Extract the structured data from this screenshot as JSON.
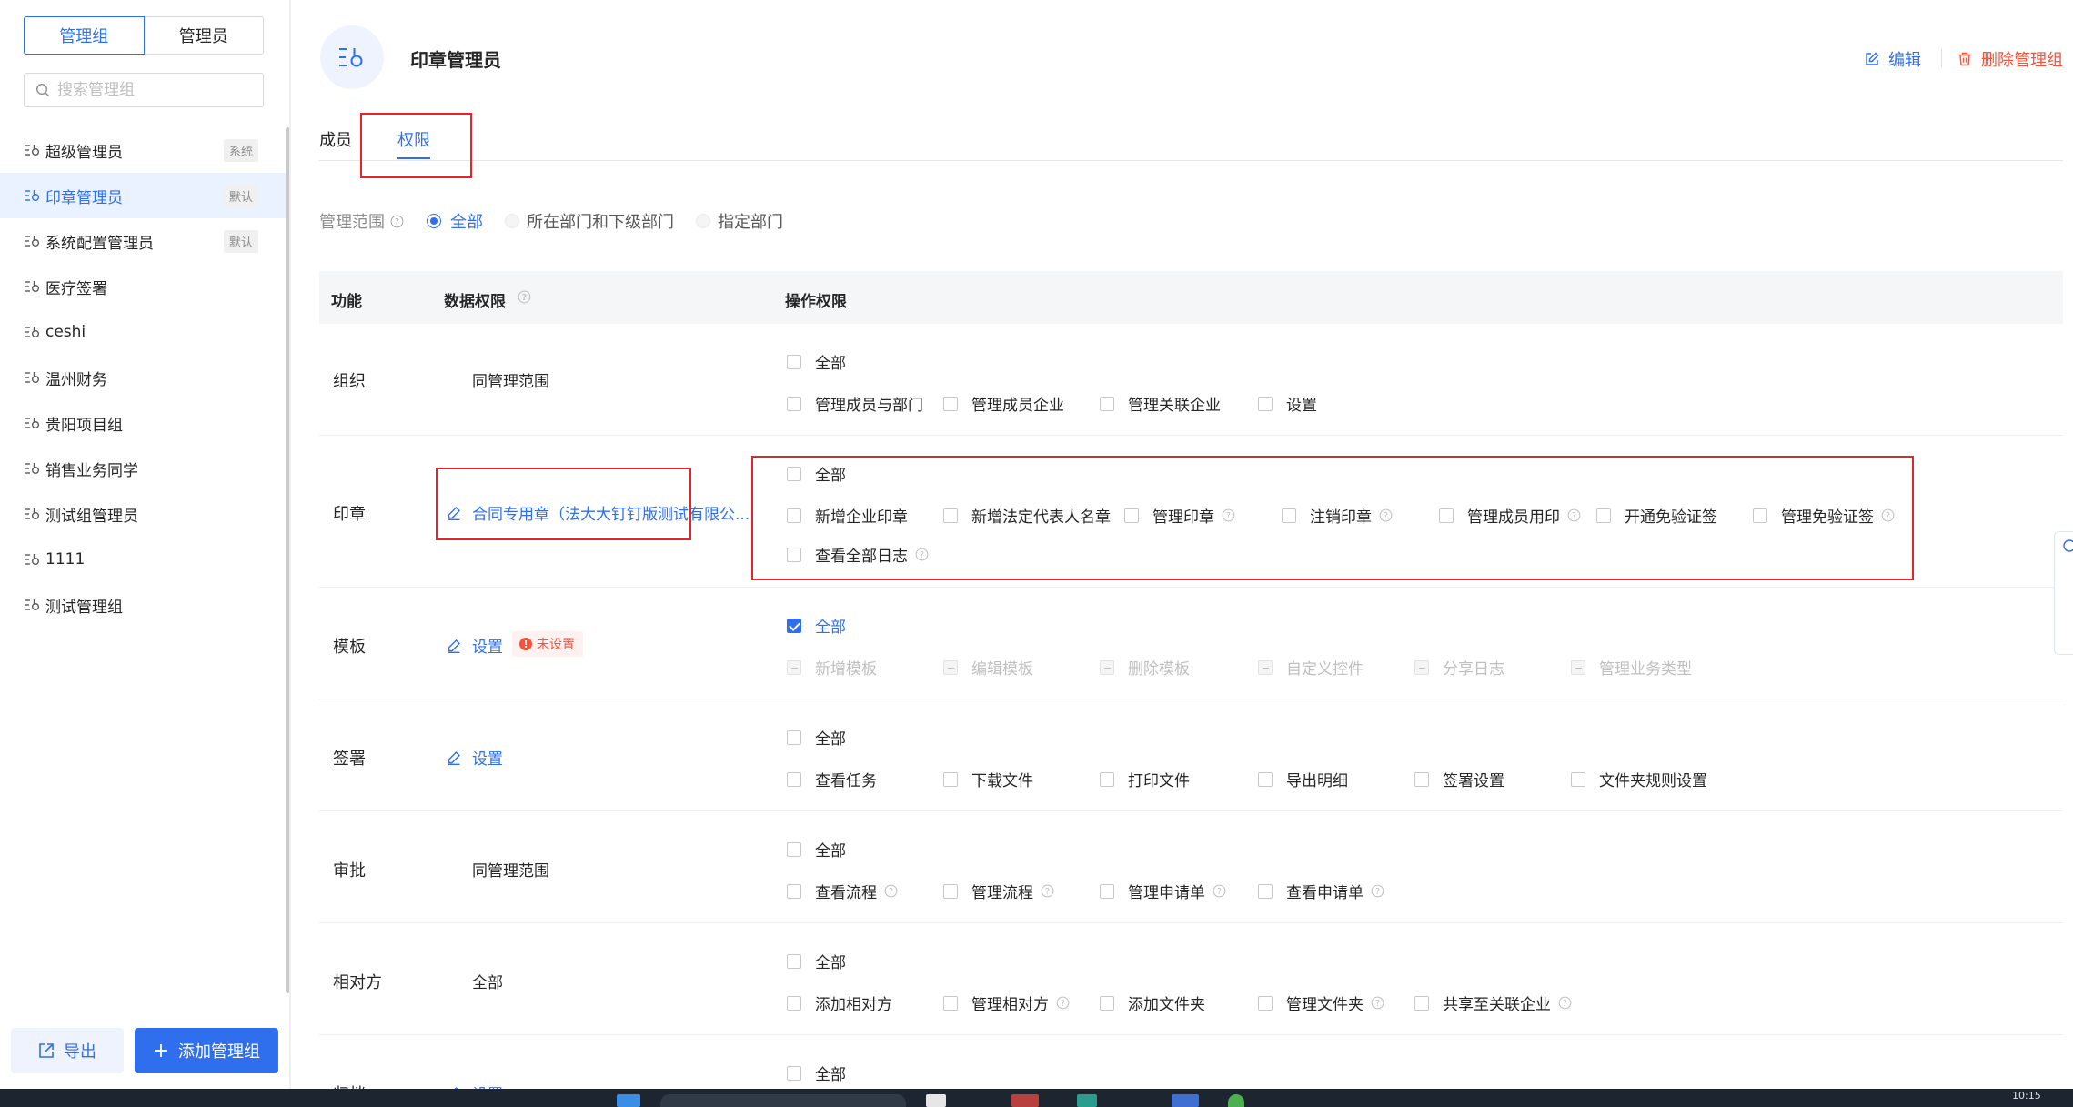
{
  "sidebar": {
    "tabs": [
      "管理组",
      "管理员"
    ],
    "search_placeholder": "搜索管理组",
    "groups": [
      {
        "name": "超级管理员",
        "tag": "系统"
      },
      {
        "name": "印章管理员",
        "tag": "默认"
      },
      {
        "name": "系统配置管理员",
        "tag": "默认"
      },
      {
        "name": "医疗签署",
        "tag": ""
      },
      {
        "name": "ceshi",
        "tag": ""
      },
      {
        "name": "温州财务",
        "tag": ""
      },
      {
        "name": "贵阳项目组",
        "tag": ""
      },
      {
        "name": "销售业务同学",
        "tag": ""
      },
      {
        "name": "测试组管理员",
        "tag": ""
      },
      {
        "name": "1111",
        "tag": ""
      },
      {
        "name": "测试管理组",
        "tag": ""
      }
    ],
    "export_label": "导出",
    "add_label": "添加管理组"
  },
  "header": {
    "title": "印章管理员",
    "edit_label": "编辑",
    "delete_label": "删除管理组"
  },
  "tabs": [
    "成员",
    "权限"
  ],
  "scope": {
    "label": "管理范围",
    "options": [
      "全部",
      "所在部门和下级部门",
      "指定部门"
    ]
  },
  "table": {
    "headers": [
      "功能",
      "数据权限",
      "操作权限"
    ],
    "rows": [
      {
        "func": "组织",
        "data": "同管理范围",
        "all": "全部",
        "ops": [
          "管理成员与部门",
          "管理成员企业",
          "管理关联企业",
          "设置"
        ]
      },
      {
        "func": "印章",
        "data": "合同专用章（法大大钉钉版测试有限公...",
        "all": "全部",
        "ops": [
          "新增企业印章",
          "新增法定代表人名章",
          "管理印章",
          "注销印章",
          "管理成员用印",
          "开通免验证签",
          "管理免验证签",
          "查看全部日志"
        ]
      },
      {
        "func": "模板",
        "data": "设置",
        "badge": "未设置",
        "all": "全部",
        "ops": [
          "新增模板",
          "编辑模板",
          "删除模板",
          "自定义控件",
          "分享日志",
          "管理业务类型"
        ]
      },
      {
        "func": "签署",
        "data": "设置",
        "all": "全部",
        "ops": [
          "查看任务",
          "下载文件",
          "打印文件",
          "导出明细",
          "签署设置",
          "文件夹规则设置"
        ]
      },
      {
        "func": "审批",
        "data": "同管理范围",
        "all": "全部",
        "ops": [
          "查看流程",
          "管理流程",
          "管理申请单",
          "查看申请单"
        ]
      },
      {
        "func": "相对方",
        "data": "全部",
        "all": "全部",
        "ops": [
          "添加相对方",
          "管理相对方",
          "添加文件夹",
          "管理文件夹",
          "共享至关联企业"
        ]
      },
      {
        "func": "归档",
        "data": "设置",
        "all": "全部"
      }
    ]
  },
  "taskbar": {
    "clock": "10:15"
  },
  "colors": {
    "accent": "#2f6fed",
    "danger": "#f5543b",
    "highlight_box": "#e5252a"
  }
}
